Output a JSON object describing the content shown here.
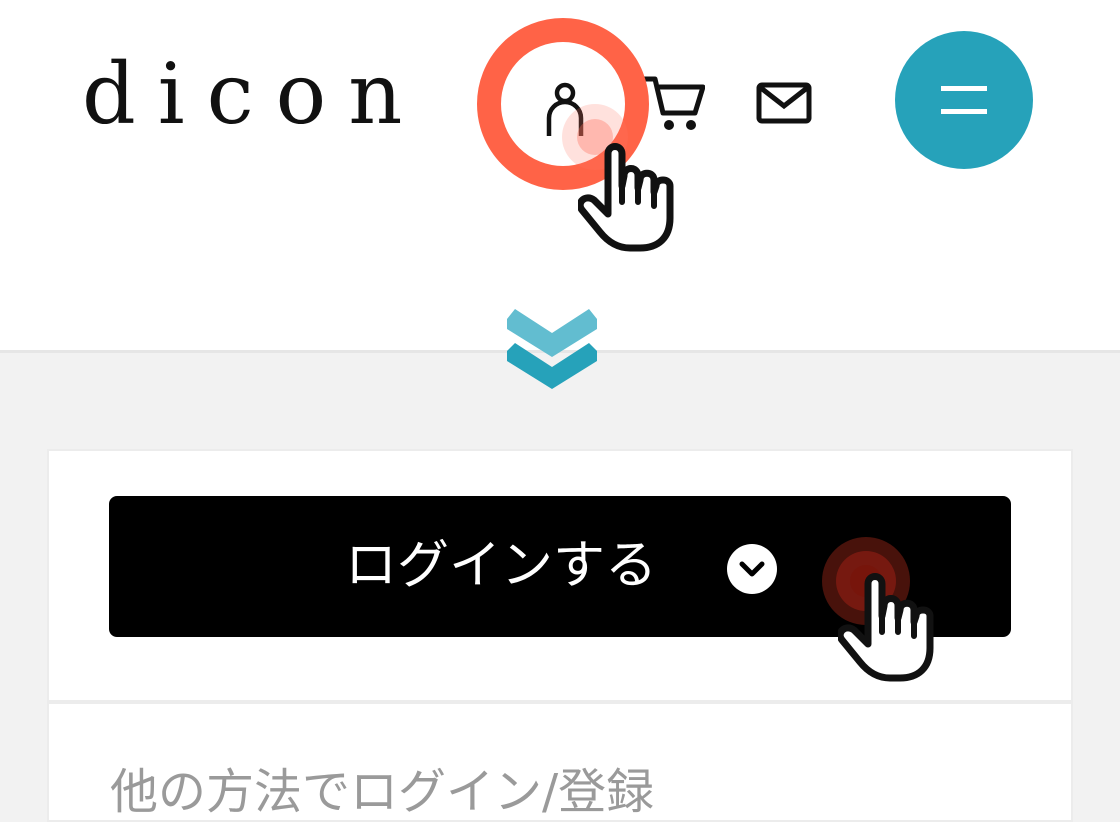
{
  "header": {
    "logo": "dicon",
    "icons": {
      "user": "user-icon",
      "cart": "cart-icon",
      "mail": "mail-icon",
      "menu": "hamburger-icon"
    }
  },
  "colors": {
    "accent_teal": "#26a2ba",
    "highlight_ring": "#ff6347",
    "button_bg": "#000000",
    "page_bg": "#f2f2f2"
  },
  "login": {
    "button_label": "ログインする"
  },
  "other": {
    "label": "他の方法でログイン/登録"
  }
}
